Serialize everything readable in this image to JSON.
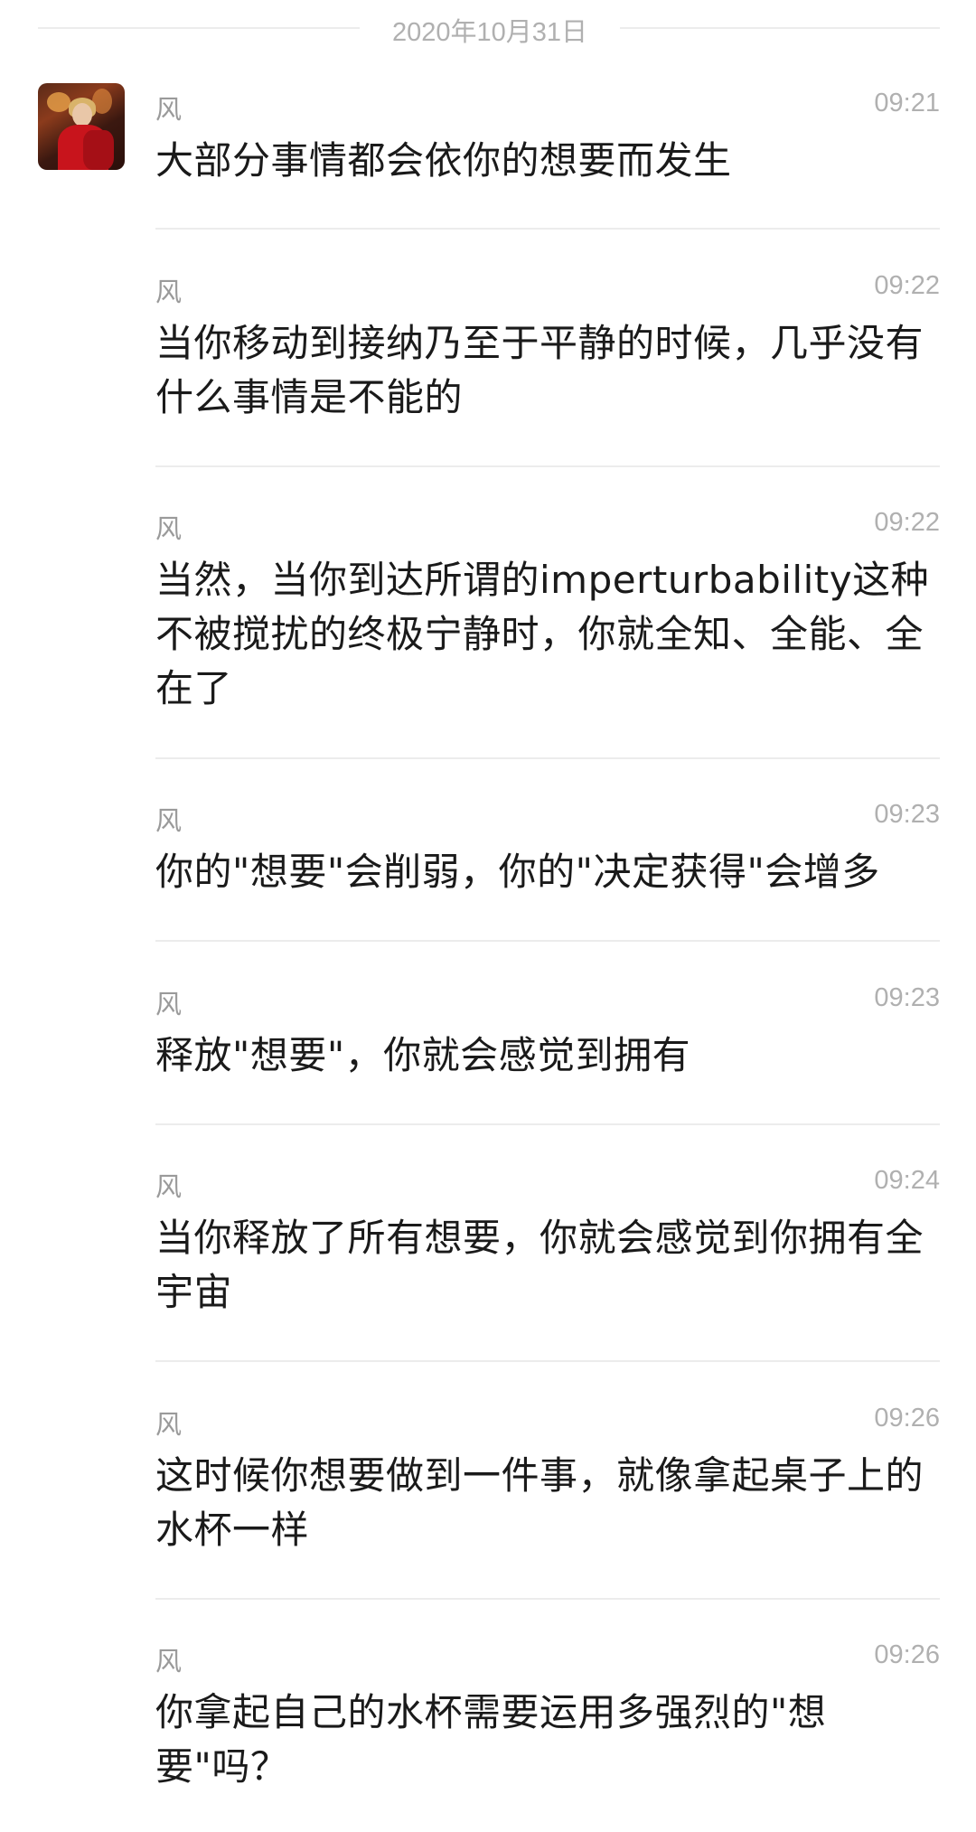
{
  "date_separator": "2020年10月31日",
  "avatar_icon": "user-avatar-photo",
  "messages": [
    {
      "sender": "风",
      "time": "09:21",
      "text": "大部分事情都会依你的想要而发生"
    },
    {
      "sender": "风",
      "time": "09:22",
      "text": "当你移动到接纳乃至于平静的时候，几乎没有什么事情是不能的"
    },
    {
      "sender": "风",
      "time": "09:22",
      "text": "当然，当你到达所谓的imperturbability这种不被搅扰的终极宁静时，你就全知、全能、全在了"
    },
    {
      "sender": "风",
      "time": "09:23",
      "text": "你的\"想要\"会削弱，你的\"决定获得\"会增多"
    },
    {
      "sender": "风",
      "time": "09:23",
      "text": "释放\"想要\"，你就会感觉到拥有"
    },
    {
      "sender": "风",
      "time": "09:24",
      "text": "当你释放了所有想要，你就会感觉到你拥有全宇宙"
    },
    {
      "sender": "风",
      "time": "09:26",
      "text": "这时候你想要做到一件事，就像拿起桌子上的水杯一样"
    },
    {
      "sender": "风",
      "time": "09:26",
      "text": "你拿起自己的水杯需要运用多强烈的\"想要\"吗？"
    }
  ]
}
